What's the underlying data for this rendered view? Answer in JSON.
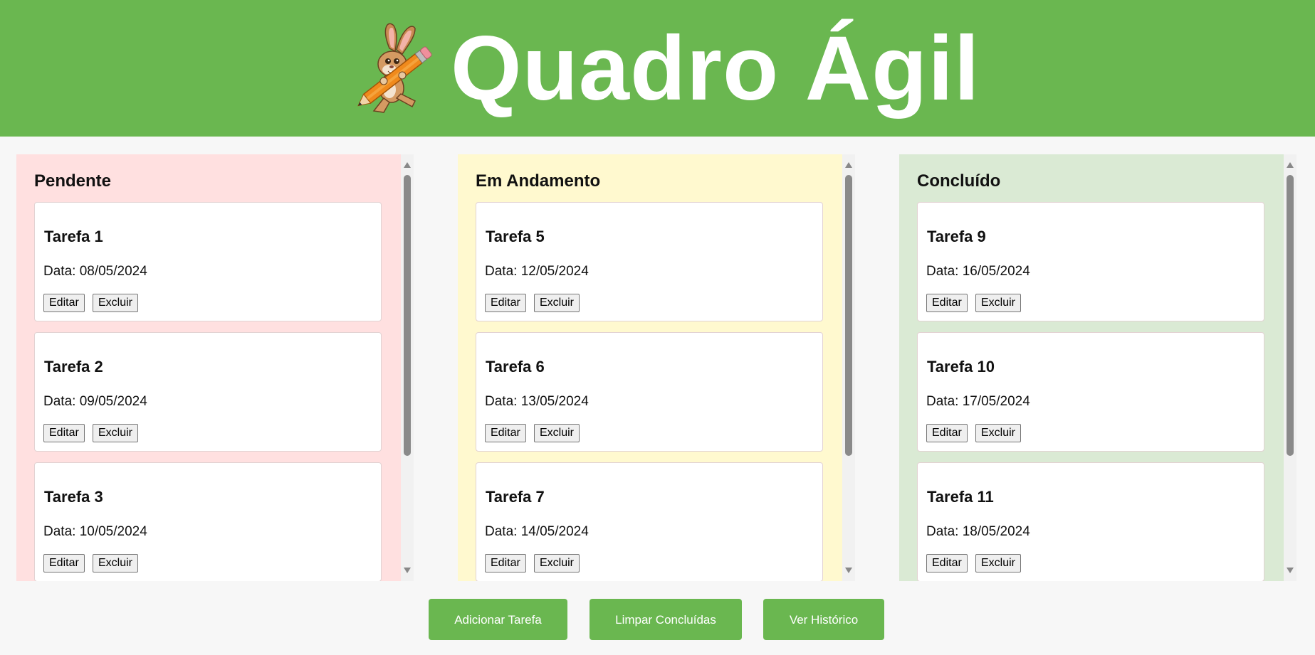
{
  "app": {
    "title": "Quadro Ágil"
  },
  "colors": {
    "header": "#6ab750",
    "pending": "#ffe0e0",
    "in_progress": "#fff9cf",
    "done": "#daead4",
    "action_button": "#6ab750"
  },
  "columns": [
    {
      "title": "Pendente",
      "tasks": [
        {
          "title": "Tarefa 1",
          "date": "Data: 08/05/2024",
          "edit": "Editar",
          "delete": "Excluir"
        },
        {
          "title": "Tarefa 2",
          "date": "Data: 09/05/2024",
          "edit": "Editar",
          "delete": "Excluir"
        },
        {
          "title": "Tarefa 3",
          "date": "Data: 10/05/2024",
          "edit": "Editar",
          "delete": "Excluir"
        }
      ]
    },
    {
      "title": "Em Andamento",
      "tasks": [
        {
          "title": "Tarefa 5",
          "date": "Data: 12/05/2024",
          "edit": "Editar",
          "delete": "Excluir"
        },
        {
          "title": "Tarefa 6",
          "date": "Data: 13/05/2024",
          "edit": "Editar",
          "delete": "Excluir"
        },
        {
          "title": "Tarefa 7",
          "date": "Data: 14/05/2024",
          "edit": "Editar",
          "delete": "Excluir"
        }
      ]
    },
    {
      "title": "Concluído",
      "tasks": [
        {
          "title": "Tarefa 9",
          "date": "Data: 16/05/2024",
          "edit": "Editar",
          "delete": "Excluir"
        },
        {
          "title": "Tarefa 10",
          "date": "Data: 17/05/2024",
          "edit": "Editar",
          "delete": "Excluir"
        },
        {
          "title": "Tarefa 11",
          "date": "Data: 18/05/2024",
          "edit": "Editar",
          "delete": "Excluir"
        }
      ]
    }
  ],
  "actions": {
    "add": "Adicionar Tarefa",
    "clear": "Limpar Concluídas",
    "history": "Ver Histórico"
  }
}
